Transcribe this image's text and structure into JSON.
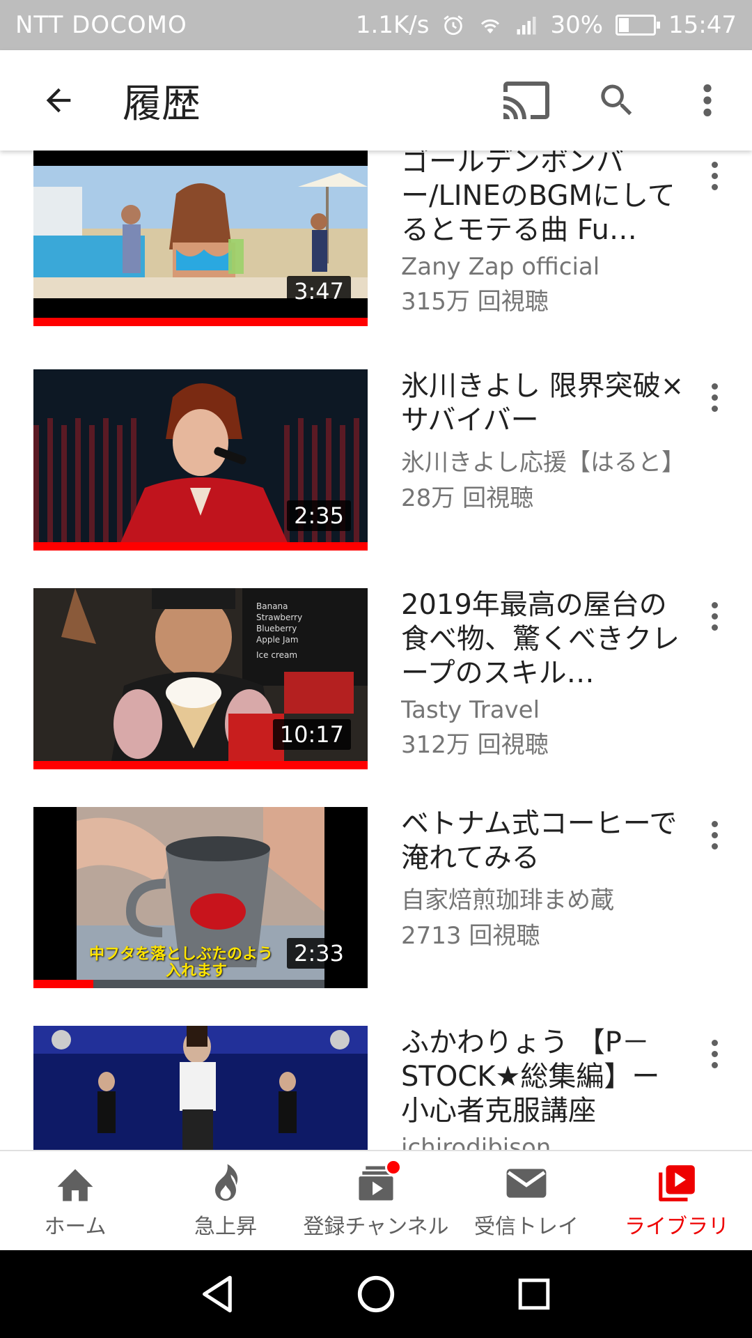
{
  "status_bar": {
    "carrier": "NTT DOCOMO",
    "network_speed": "1.1K/s",
    "battery": "30%",
    "battery_level": 0.3,
    "time": "15:47"
  },
  "app_bar": {
    "title": "履歴"
  },
  "videos": [
    {
      "title": "ゴールデンボンバー/LINEのBGMにしてるとモテる曲 Fu…",
      "channel": "Zany Zap official",
      "views": "315万 回視聴",
      "duration": "3:47",
      "watched_fraction": 1.0
    },
    {
      "title": "氷川きよし 限界突破×サバイバー",
      "channel": "氷川きよし応援【はると】",
      "views": "28万 回視聴",
      "duration": "2:35",
      "watched_fraction": 1.0
    },
    {
      "title": "2019年最高の屋台の食べ物、驚くべきクレープのスキル…",
      "channel": "Tasty Travel",
      "views": "312万 回視聴",
      "duration": "10:17",
      "watched_fraction": 1.0
    },
    {
      "title": "ベトナム式コーヒーで淹れてみる",
      "channel": "自家焙煎珈琲まめ蔵",
      "views": "2713 回視聴",
      "duration": "2:33",
      "watched_fraction": 0.18,
      "caption_line1": "中フタを落としぶたのよう",
      "caption_line2": "入れます"
    },
    {
      "title": "ふかわりょう 【P－STOCK★総集編】ー小心者克服講座",
      "channel": "ichirodibison",
      "views": "",
      "duration": "",
      "watched_fraction": 0
    }
  ],
  "bottom_nav": {
    "items": [
      {
        "label": "ホーム",
        "icon": "home-icon"
      },
      {
        "label": "急上昇",
        "icon": "trending-icon"
      },
      {
        "label": "登録チャンネル",
        "icon": "subscriptions-icon",
        "has_badge": true
      },
      {
        "label": "受信トレイ",
        "icon": "inbox-icon"
      },
      {
        "label": "ライブラリ",
        "icon": "library-icon",
        "active": true
      }
    ],
    "active_color": "#e00000"
  },
  "colors": {
    "accent": "#ff0000",
    "status_bar": "#bdbdbd",
    "text_primary": "#212121",
    "text_secondary": "#757575"
  }
}
